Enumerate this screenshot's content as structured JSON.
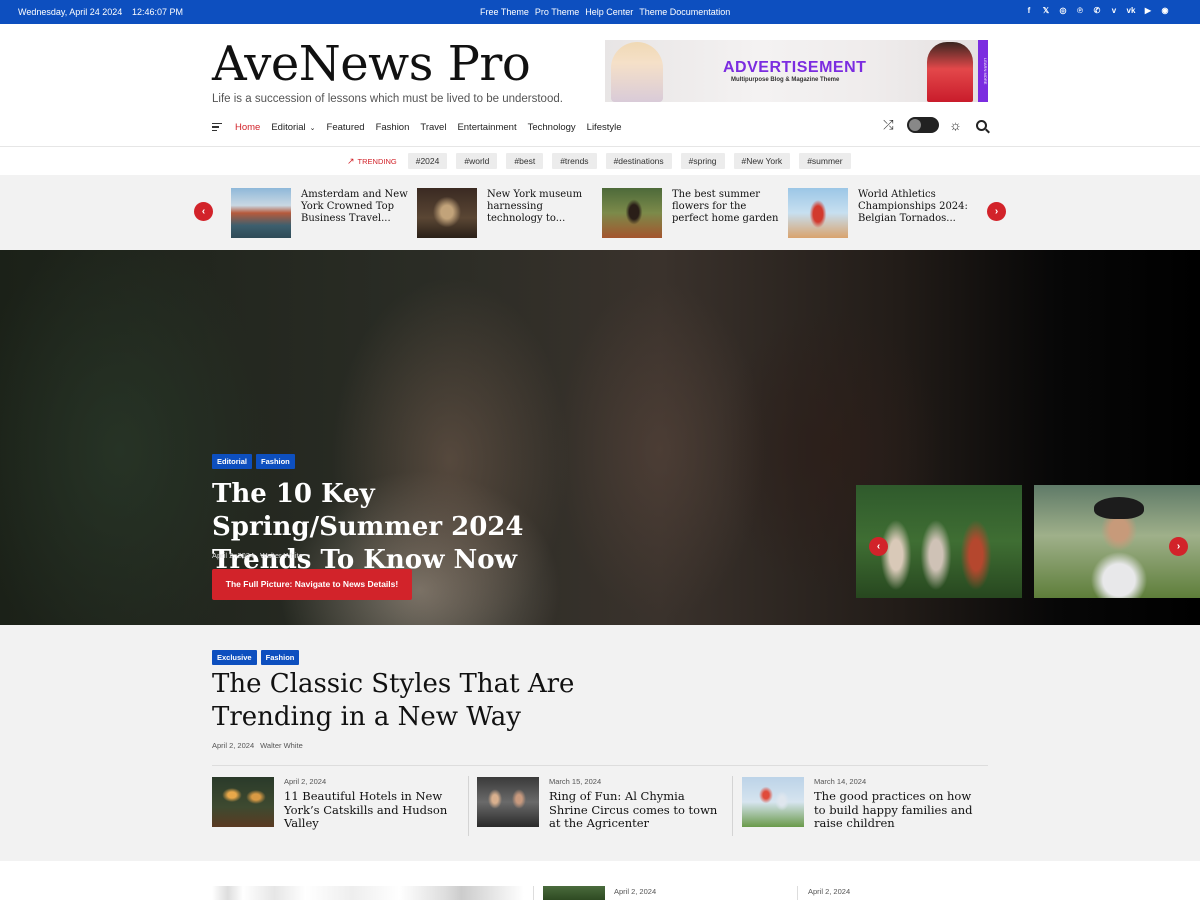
{
  "topbar": {
    "date": "Wednesday, April 24 2024",
    "time": "12:46:07 PM",
    "links": [
      "Free Theme",
      "Pro Theme",
      "Help Center",
      "Theme Documentation"
    ],
    "social": [
      {
        "icon": "facebook-icon",
        "glyph": "f"
      },
      {
        "icon": "x-icon",
        "glyph": "𝕏"
      },
      {
        "icon": "instagram-icon",
        "glyph": "◎"
      },
      {
        "icon": "pinterest-icon",
        "glyph": "℗"
      },
      {
        "icon": "whatsapp-icon",
        "glyph": "✆"
      },
      {
        "icon": "vimeo-icon",
        "glyph": "v"
      },
      {
        "icon": "vk-icon",
        "glyph": "vk"
      },
      {
        "icon": "youtube-icon",
        "glyph": "▶"
      },
      {
        "icon": "spotify-icon",
        "glyph": "◉"
      }
    ]
  },
  "header": {
    "site_title": "AveNews Pro",
    "tagline": "Life is a succession of lessons which must be lived to be understood.",
    "ad": {
      "title": "ADVERTISEMENT",
      "subtitle": "Multipurpose Blog & Magazine Theme",
      "tag": "LEARN MORE"
    }
  },
  "nav": {
    "items": [
      {
        "label": "Home",
        "active": true
      },
      {
        "label": "Editorial",
        "dropdown": true
      },
      {
        "label": "Featured"
      },
      {
        "label": "Fashion"
      },
      {
        "label": "Travel"
      },
      {
        "label": "Entertainment"
      },
      {
        "label": "Technology"
      },
      {
        "label": "Lifestyle"
      }
    ]
  },
  "trending": {
    "label": "TRENDING",
    "tags": [
      "#2024",
      "#world",
      "#best",
      "#trends",
      "#destinations",
      "#spring",
      "#New York",
      "#summer"
    ]
  },
  "strip": {
    "items": [
      {
        "title": "Amsterdam and New York Crowned Top Business Travel..."
      },
      {
        "title": "New York museum harnessing technology to..."
      },
      {
        "title": "The best summer flowers for the perfect home garden"
      },
      {
        "title": "World Athletics Championships 2024: Belgian Tornados..."
      }
    ]
  },
  "hero": {
    "categories": [
      "Editorial",
      "Fashion"
    ],
    "title": "The 10 Key Spring/Summer 2024 Trends To Know Now",
    "date": "April 2, 2024",
    "author": "Walter White",
    "cta": "The Full Picture: Navigate to News Details!"
  },
  "featured": {
    "categories": [
      "Exclusive",
      "Fashion"
    ],
    "title": "The Classic Styles That Are Trending in a New Way",
    "date": "April 2, 2024",
    "author": "Walter White",
    "cards": [
      {
        "date": "April 2, 2024",
        "title": "11 Beautiful Hotels in New York’s Catskills and Hudson Valley"
      },
      {
        "date": "March 15, 2024",
        "title": "Ring of Fun: Al Chymia Shrine Circus comes to town at the Agricenter"
      },
      {
        "date": "March 14, 2024",
        "title": "The good practices on how to build happy families and raise children"
      }
    ]
  },
  "bottom": {
    "dates": [
      "April 2, 2024",
      "April 2, 2024"
    ]
  },
  "colors": {
    "brand_blue": "#0d4fbf",
    "accent_red": "#d2232a",
    "ad_purple": "#7b2ce0"
  }
}
